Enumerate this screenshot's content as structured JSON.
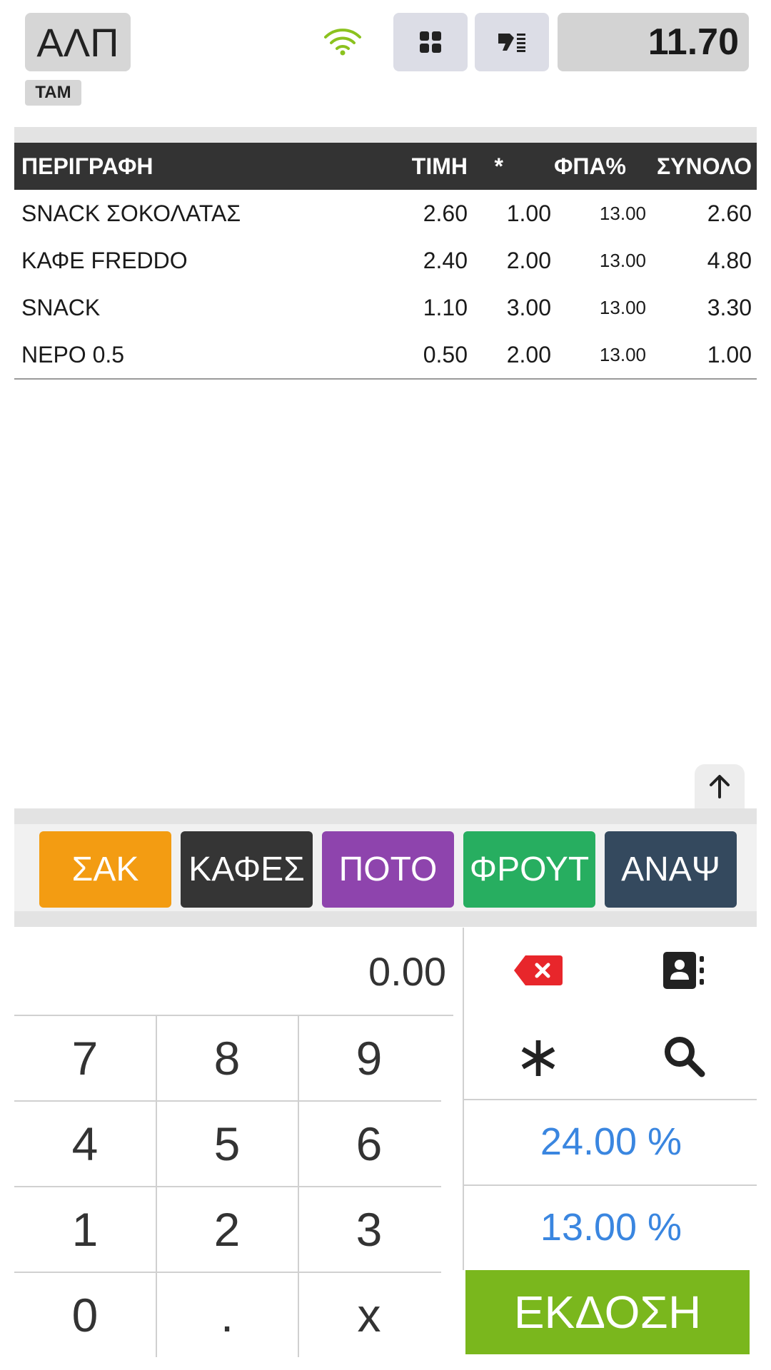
{
  "header": {
    "mode_label": "ΑΛΠ",
    "register_label": "ΤΑΜ",
    "total": "11.70",
    "icons": [
      "wifi-icon",
      "grid-icon",
      "tag-list-icon"
    ],
    "wifi_color": "#8bc21f"
  },
  "table": {
    "headers": {
      "description": "ΠΕΡΙΓΡΑΦΗ",
      "price": "ΤΙΜΗ",
      "quantity": "*",
      "vat": "ΦΠΑ%",
      "total": "ΣΥΝΟΛΟ"
    },
    "rows": [
      {
        "description": "SNACK ΣΟΚΟΛΑΤΑΣ",
        "price": "2.60",
        "quantity": "1.00",
        "vat": "13.00",
        "total": "2.60"
      },
      {
        "description": "ΚΑΦΕ FREDDO",
        "price": "2.40",
        "quantity": "2.00",
        "vat": "13.00",
        "total": "4.80"
      },
      {
        "description": "SNACK",
        "price": "1.10",
        "quantity": "3.00",
        "vat": "13.00",
        "total": "3.30"
      },
      {
        "description": "ΝΕΡΟ 0.5",
        "price": "0.50",
        "quantity": "2.00",
        "vat": "13.00",
        "total": "1.00"
      }
    ]
  },
  "categories": [
    {
      "label": "ΣΑΚ",
      "color": "#f39c12"
    },
    {
      "label": "ΚΑΦΕΣ",
      "color": "#353535"
    },
    {
      "label": "ΠΟΤΟ",
      "color": "#8e44ad"
    },
    {
      "label": "ΦΡΟΥΤ",
      "color": "#27ae60"
    },
    {
      "label": "ΑΝΑΨ",
      "color": "#34495e"
    }
  ],
  "keypad": {
    "amount": "0.00",
    "keys": [
      "7",
      "8",
      "9",
      "4",
      "5",
      "6",
      "1",
      "2",
      "3",
      "0",
      ".",
      "x"
    ],
    "multiply_symbol": "∗",
    "vat_options": [
      "24.00 %",
      "13.00 %"
    ],
    "issue_label": "ΕΚΔΟΣΗ",
    "icons": [
      "backspace-icon",
      "contact-book-icon",
      "multiply-icon",
      "search-icon"
    ],
    "vat_color": "#3a86e0",
    "issue_color": "#7ab71d",
    "backspace_color": "#e8262b"
  }
}
